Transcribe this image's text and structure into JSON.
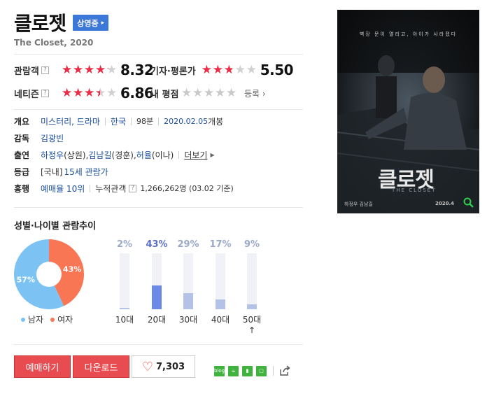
{
  "movie": {
    "title": "클로젯",
    "status_badge": "상영중",
    "subtitle": "The Closet, 2020"
  },
  "ratings": {
    "audience": {
      "label": "관람객",
      "score": "8.32",
      "value": 8.32
    },
    "critic": {
      "label": "기자·평론가",
      "score": "5.50",
      "value": 5.5
    },
    "netizen": {
      "label": "네티즌",
      "score": "6.86",
      "value": 6.86
    },
    "mine": {
      "label": "내 평점",
      "register": "등록",
      "value": 0
    },
    "help_icon": "?"
  },
  "info": {
    "overview": {
      "label": "개요",
      "genre": "미스터리, 드라마",
      "country": "한국",
      "runtime": "98분",
      "release_date": "2020.02.05",
      "release_suffix": "개봉"
    },
    "director": {
      "label": "감독",
      "name": "김광빈"
    },
    "cast": {
      "label": "출연",
      "actor1": "하정우",
      "role1": "(상원), ",
      "actor2": "김남길",
      "role2": "(경훈), ",
      "actor3": "허율",
      "role3": "(이나)",
      "more": "더보기"
    },
    "grade": {
      "label": "등급",
      "prefix": "[국내]",
      "value": "15세 관람가"
    },
    "boxoffice": {
      "label": "흥행",
      "rank": "예매율 10위",
      "cumulative_label": "누적관객",
      "cumulative_value": "1,266,262명 (03.02 기준)"
    }
  },
  "poster": {
    "tagline": "벽장 문이 열리고, 아이가 사라졌다",
    "title": "클로젯",
    "subtitle": "THE CLOSET",
    "credits": "하정우   김남길",
    "date": "2020.4",
    "icon": "zoom-icon"
  },
  "chart_data": [
    {
      "type": "pie",
      "title": "성별·나이별 관람추이",
      "categories": [
        "남자",
        "여자"
      ],
      "values": [
        57,
        43
      ],
      "labels": [
        "57%",
        "43%"
      ],
      "colors": [
        "#7cc3f4",
        "#f87654"
      ]
    },
    {
      "type": "bar",
      "categories": [
        "10대",
        "20대",
        "30대",
        "40대",
        "50대↑"
      ],
      "values": [
        2,
        43,
        29,
        17,
        9
      ],
      "labels": [
        "2%",
        "43%",
        "29%",
        "17%",
        "9%"
      ],
      "ylim": [
        0,
        100
      ],
      "highlight_index": 1,
      "colors": {
        "bar": "#b3c2e6",
        "highlight": "#6b8ae8",
        "track": "#f0f2f7"
      }
    }
  ],
  "actions": {
    "reserve": "예매하기",
    "download": "다운로드",
    "likes": "7,303"
  },
  "share": {
    "icons": [
      "blog-icon",
      "cafe-icon",
      "bookmark-icon",
      "memo-icon",
      "share-icon"
    ],
    "blog_text": "blog"
  },
  "colors": {
    "star_red": "#ec2c49",
    "badge_blue": "#3b78d8",
    "button_red": "#e84c51",
    "link_blue": "#1b4e9b"
  }
}
